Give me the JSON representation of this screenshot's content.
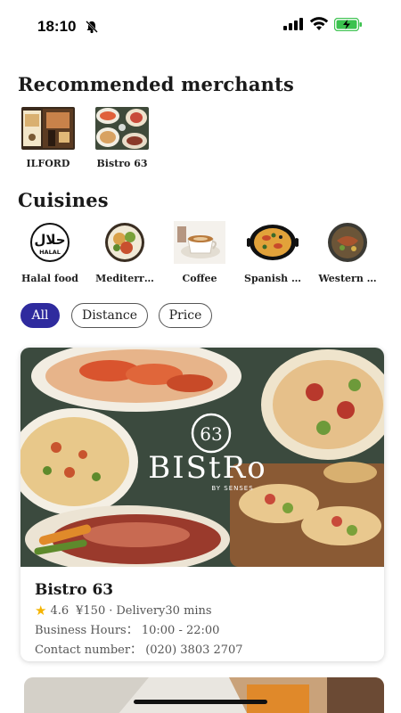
{
  "status": {
    "time": "18:10"
  },
  "sections": {
    "recommended_title": "Recommended merchants",
    "cuisines_title": "Cuisines"
  },
  "merchants": [
    {
      "name": "ILFORD",
      "icon": "restaurant-storefront-photo"
    },
    {
      "name": "Bistro 63",
      "icon": "food-platter-photo"
    }
  ],
  "cuisines": [
    {
      "name": "Halal food",
      "icon": "halal-logo",
      "logo_text": "حلال",
      "logo_sub": "HALAL"
    },
    {
      "name": "Mediterr…",
      "icon": "mediterranean-dish-photo"
    },
    {
      "name": "Coffee",
      "icon": "coffee-cup-photo"
    },
    {
      "name": "Spanish …",
      "icon": "paella-pan-photo"
    },
    {
      "name": "Western …",
      "icon": "western-dish-photo"
    }
  ],
  "filters": [
    {
      "label": "All",
      "active": true
    },
    {
      "label": "Distance",
      "active": false
    },
    {
      "label": "Price",
      "active": false
    }
  ],
  "restaurant": {
    "name": "Bistro 63",
    "rating": "4.6",
    "price": "¥150",
    "delivery": "Delivery30 mins",
    "hours": "Business Hours：  10:00 - 22:00",
    "phone": "Contact number：  (020) 3803 2707",
    "brand_logo": "63",
    "brand_name": "BIStRo",
    "brand_sub": "BY SENSES"
  },
  "colors": {
    "accent": "#2f2b9e",
    "star": "#f5b400"
  }
}
